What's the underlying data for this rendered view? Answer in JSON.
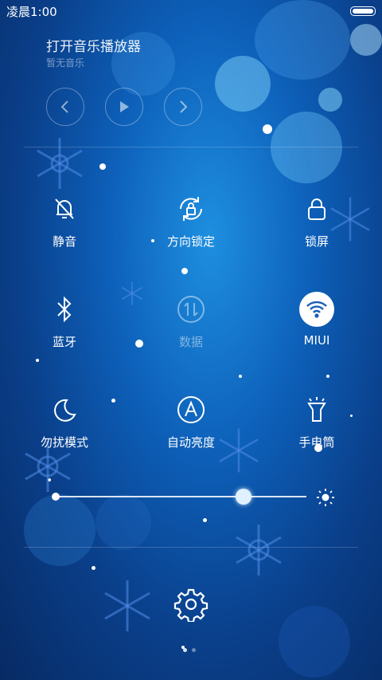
{
  "status_bar": {
    "time": "凌晨1:00"
  },
  "music": {
    "title": "打开音乐播放器",
    "subtitle": "暂无音乐",
    "controls": [
      "previous-icon",
      "play-icon",
      "next-icon"
    ]
  },
  "toggles": [
    {
      "label": "静音",
      "icon": "mute-bell-icon",
      "enabled": true
    },
    {
      "label": "方向锁定",
      "icon": "rotation-lock-icon",
      "enabled": true
    },
    {
      "label": "锁屏",
      "icon": "lock-icon",
      "enabled": true
    },
    {
      "label": "蓝牙",
      "icon": "bluetooth-icon",
      "enabled": true
    },
    {
      "label": "数据",
      "icon": "data-icon",
      "enabled": false
    },
    {
      "label": "MIUI",
      "icon": "wifi-icon",
      "enabled": true,
      "active": true
    },
    {
      "label": "勿扰模式",
      "icon": "moon-icon",
      "enabled": true
    },
    {
      "label": "自动亮度",
      "icon": "auto-brightness-icon",
      "enabled": true
    },
    {
      "label": "手电筒",
      "icon": "flashlight-icon",
      "enabled": true
    }
  ],
  "brightness": {
    "level": 0.75
  },
  "settings": {
    "icon": "gear-icon"
  },
  "pager": {
    "count": 2,
    "active": 1
  }
}
